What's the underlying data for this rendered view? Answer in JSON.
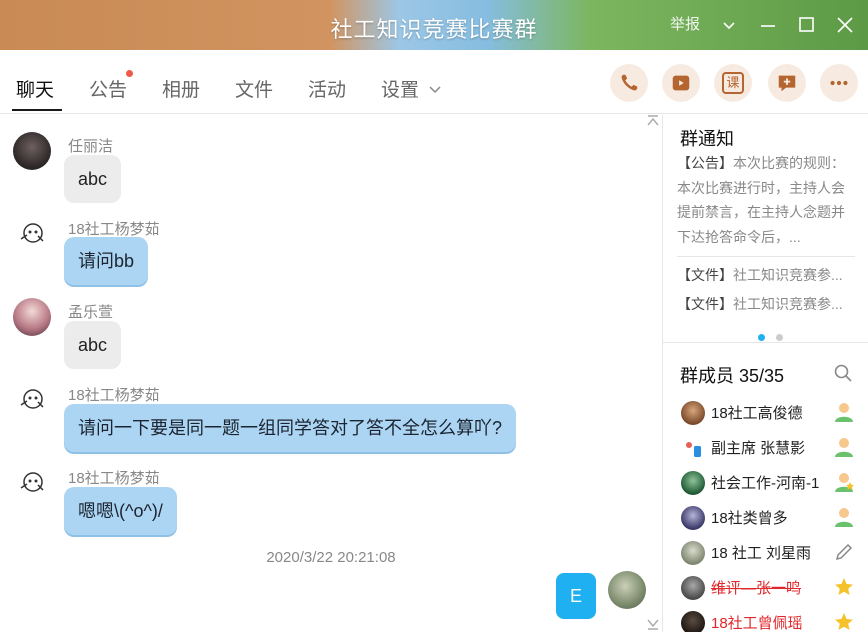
{
  "window": {
    "title": "社工知识竞赛比赛群",
    "report_label": "举报"
  },
  "tabs": [
    {
      "label": "聊天",
      "active": true
    },
    {
      "label": "公告",
      "has_dot": true
    },
    {
      "label": "相册"
    },
    {
      "label": "文件"
    },
    {
      "label": "活动"
    },
    {
      "label": "设置"
    }
  ],
  "toolbar": {
    "course_label": "课"
  },
  "messages": [
    {
      "sender": "任丽洁",
      "text": "abc",
      "style": "gray"
    },
    {
      "sender": "18社工杨梦茹",
      "text": "请问bb",
      "style": "blue"
    },
    {
      "sender": "孟乐萱",
      "text": "abc",
      "style": "gray"
    },
    {
      "sender": "18社工杨梦茹",
      "text": "请问一下要是同一题一组同学答对了答不全怎么算吖?",
      "style": "blue"
    },
    {
      "sender": "18社工杨梦茹",
      "text": "嗯嗯\\(^o^)/",
      "style": "blue"
    }
  ],
  "timestamp": "2020/3/22 20:21:08",
  "self_message": {
    "text": "E"
  },
  "notice": {
    "title": "群通知",
    "announcement_tag": "【公告】",
    "announcement_text": "本次比赛的规则：本次比赛进行时，主持人会提前禁言，在主持人念题并下达抢答命令后，...",
    "files": [
      {
        "tag": "【文件】",
        "name": "社工知识竞赛参..."
      },
      {
        "tag": "【文件】",
        "name": "社工知识竞赛参..."
      }
    ]
  },
  "members": {
    "title": "群成员 35/35",
    "list": [
      {
        "name": "18社工高俊德",
        "role": "member",
        "style": "normal"
      },
      {
        "name": "副主席 张慧影",
        "role": "member",
        "style": "normal"
      },
      {
        "name": "社会工作-河南-1",
        "role": "member-star",
        "style": "normal"
      },
      {
        "name": "18社类曾多",
        "role": "member",
        "style": "normal"
      },
      {
        "name": "18 社工 刘星雨",
        "role": "edit",
        "style": "normal"
      },
      {
        "name": "维评—张一鸣",
        "role": "admin",
        "style": "red-strike"
      },
      {
        "name": "18社工曾佩瑶",
        "role": "admin",
        "style": "red"
      }
    ]
  },
  "colors": {
    "bubble_blue": "#acd5f3",
    "bubble_gray": "#ececec",
    "self_bubble": "#1eb0f0",
    "tool_bg": "#f7ebe1",
    "tool_icon": "#b5652f",
    "red_name": "#e0272a"
  },
  "icons": [
    "phone-icon",
    "video-icon",
    "course-icon",
    "add-app-icon",
    "more-icon",
    "search-icon",
    "minimize-icon",
    "maximize-icon",
    "close-icon",
    "chevron-down-icon"
  ]
}
